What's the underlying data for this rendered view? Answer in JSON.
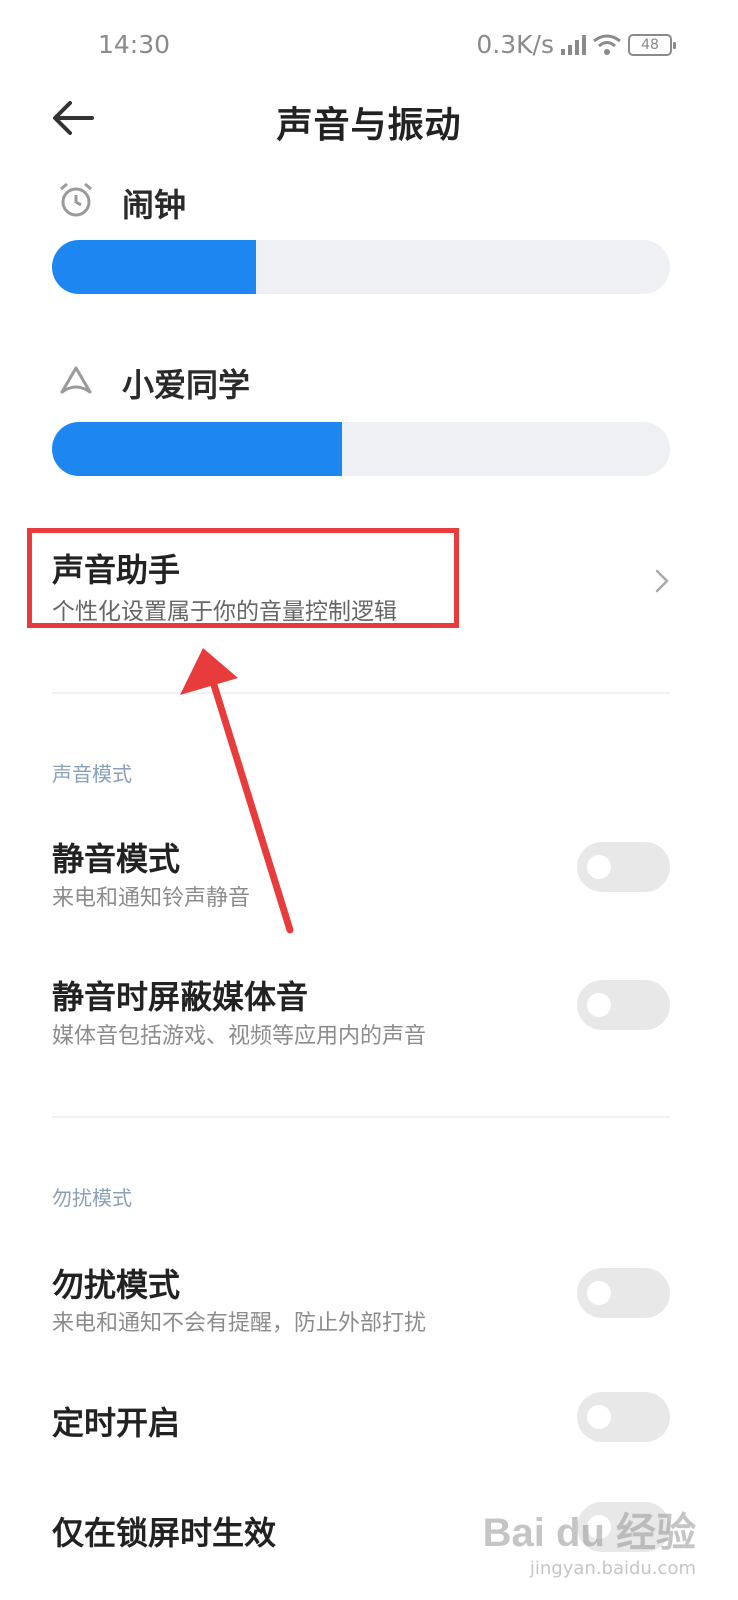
{
  "status_bar": {
    "time": "14:30",
    "network_speed": "0.3K/s",
    "battery": "48",
    "icons": [
      "signal-icon",
      "wifi-icon",
      "battery-icon"
    ]
  },
  "header": {
    "title": "声音与振动",
    "back_icon": "back-arrow-icon"
  },
  "volumes": [
    {
      "label": "闹钟",
      "icon": "alarm-clock-icon",
      "level_percent": 33
    },
    {
      "label": "小爱同学",
      "icon": "xiaoai-assistant-icon",
      "level_percent": 47
    }
  ],
  "sound_assistant": {
    "title": "声音助手",
    "subtitle": "个性化设置属于你的音量控制逻辑",
    "chevron_icon": "chevron-right-icon"
  },
  "sections": [
    {
      "header": "声音模式",
      "items": [
        {
          "title": "静音模式",
          "subtitle": "来电和通知铃声静音",
          "toggle_on": false
        },
        {
          "title": "静音时屏蔽媒体音",
          "subtitle": "媒体音包括游戏、视频等应用内的声音",
          "toggle_on": false
        }
      ]
    },
    {
      "header": "勿扰模式",
      "items": [
        {
          "title": "勿扰模式",
          "subtitle": "来电和通知不会有提醒，防止外部打扰",
          "toggle_on": false
        },
        {
          "title": "定时开启",
          "toggle_on": false
        },
        {
          "title": "仅在锁屏时生效",
          "toggle_on": false
        }
      ]
    }
  ],
  "annotation": {
    "highlight_color": "#e83b3b",
    "arrow_color": "#e83b3b"
  },
  "watermark": {
    "main": "Bai du 经验",
    "sub": "jingyan.baidu.com"
  },
  "colors": {
    "accent": "#1d86f0",
    "track": "#eef0f4"
  }
}
